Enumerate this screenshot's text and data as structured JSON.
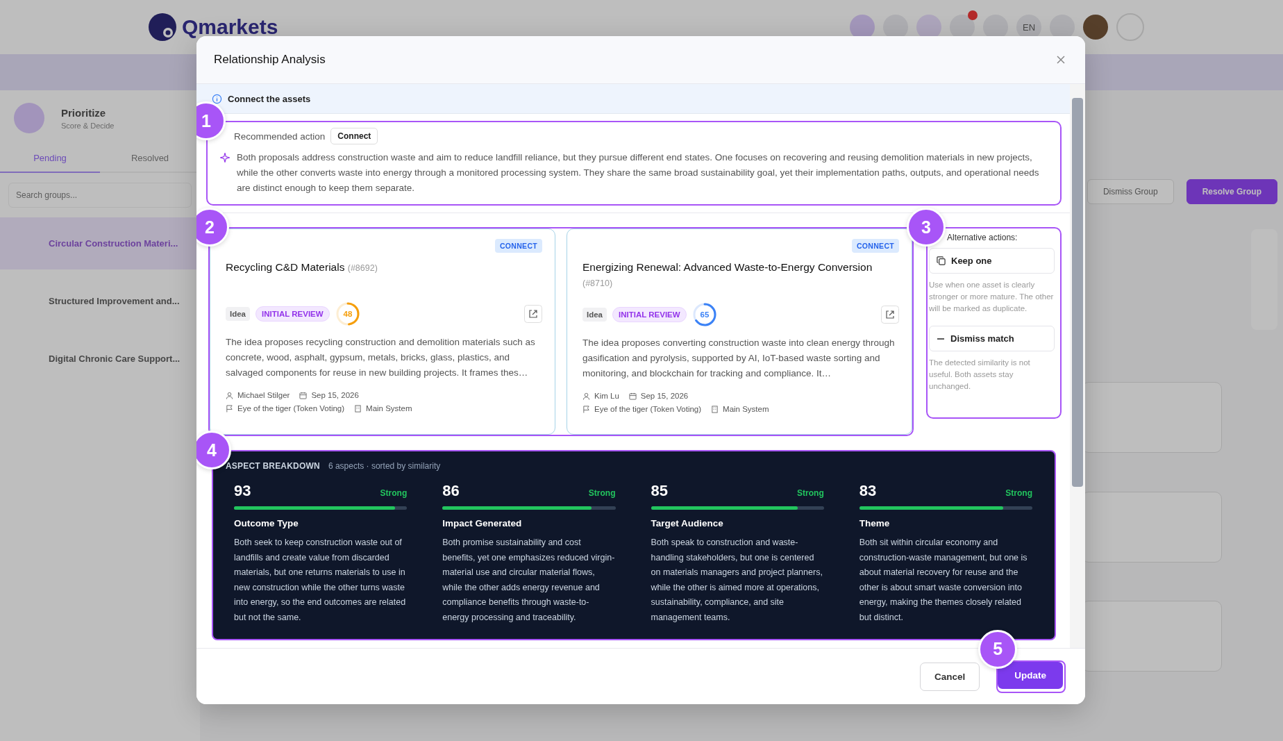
{
  "background": {
    "logo": "Qmarkets",
    "language": "EN",
    "stage": {
      "title": "Prioritize",
      "subtitle": "Score & Decide"
    },
    "tabs": [
      {
        "label": "Pending",
        "selected": true
      },
      {
        "label": "Resolved",
        "selected": false
      }
    ],
    "search": {
      "placeholder": "Search groups..."
    },
    "groups": [
      {
        "title": "Circular Construction Materi...",
        "selected": true
      },
      {
        "title": "Structured Improvement and...",
        "selected": false
      },
      {
        "title": "Digital Chronic Care Support...",
        "selected": false
      }
    ],
    "actions": [
      {
        "kind": "secondary",
        "label": "Dismiss Group"
      },
      {
        "kind": "primary",
        "label": "Resolve Group"
      }
    ]
  },
  "modal": {
    "title": "Relationship Analysis",
    "banner": "Connect the assets",
    "recommendation": {
      "label": "Recommended action",
      "action": "Connect",
      "text": "Both proposals address construction waste and aim to reduce landfill reliance, but they pursue different end states. One focuses on recovering and reusing demolition materials in new projects, while the other converts waste into energy through a monitored processing system. They share the same broad sustainability goal, yet their implementation paths, outputs, and operational needs are distinct enough to keep them separate."
    },
    "assets": [
      {
        "badge": "CONNECT",
        "title": "Recycling C&D Materials",
        "number": "(#8692)",
        "type": "Idea",
        "status": "INITIAL REVIEW",
        "score": "48",
        "color": "#f59e0b",
        "description": "The idea proposes recycling construction and demolition materials such as concrete, wood, asphalt, gypsum, metals, bricks, glass, plastics, and salvaged components for reuse in new building projects. It frames thes…",
        "author": "Michael Stilger",
        "date": "Sep 15, 2026",
        "campaign": "Eye of the tiger (Token Voting)",
        "system": "Main System"
      },
      {
        "badge": "CONNECT",
        "title": "Energizing Renewal: Advanced Waste-to-Energy Conversion",
        "number": "(#8710)",
        "type": "Idea",
        "status": "INITIAL REVIEW",
        "score": "65",
        "color": "#3b82f6",
        "description": "The idea proposes converting construction waste into clean energy through gasification and pyrolysis, supported by AI, IoT-based waste sorting and monitoring, and blockchain for tracking and compliance. It…",
        "author": "Kim Lu",
        "date": "Sep 15, 2026",
        "campaign": "Eye of the tiger (Token Voting)",
        "system": "Main System"
      }
    ],
    "alternatives": {
      "title": "Alternative actions:",
      "items": [
        {
          "kind": "keep",
          "label": "Keep one",
          "hint": "Use when one asset is clearly stronger or more mature. The other will be marked as duplicate."
        },
        {
          "kind": "dismiss",
          "label": "Dismiss match",
          "hint": "The detected similarity is not useful. Both assets stay unchanged."
        }
      ]
    },
    "breakdown": {
      "title": "ASPECT BREAKDOWN",
      "meta": "6 aspects · sorted by similarity",
      "aspects": [
        {
          "score": "93",
          "level": 0.93,
          "strength": "Strong",
          "name": "Outcome Type",
          "text": "Both seek to keep construction waste out of landfills and create value from discarded materials, but one returns materials to use in new construction while the other turns waste into energy, so the end outcomes are related but not the same."
        },
        {
          "score": "86",
          "level": 0.86,
          "strength": "Strong",
          "name": "Impact Generated",
          "text": "Both promise sustainability and cost benefits, yet one emphasizes reduced virgin-material use and circular material flows, while the other adds energy revenue and compliance benefits through waste-to-energy processing and traceability."
        },
        {
          "score": "85",
          "level": 0.85,
          "strength": "Strong",
          "name": "Target Audience",
          "text": "Both speak to construction and waste-handling stakeholders, but one is centered on materials managers and project planners, while the other is aimed more at operations, sustainability, compliance, and site management teams."
        },
        {
          "score": "83",
          "level": 0.83,
          "strength": "Strong",
          "name": "Theme",
          "text": "Both sit within circular economy and construction-waste management, but one is about material recovery for reuse and the other is about smart waste conversion into energy, making the themes closely related but distinct."
        }
      ]
    },
    "buttons": [
      {
        "kind": "secondary",
        "label": "Cancel"
      },
      {
        "kind": "primary",
        "label": "Update"
      }
    ]
  },
  "callouts": [
    "1",
    "2",
    "3",
    "4",
    "5"
  ]
}
